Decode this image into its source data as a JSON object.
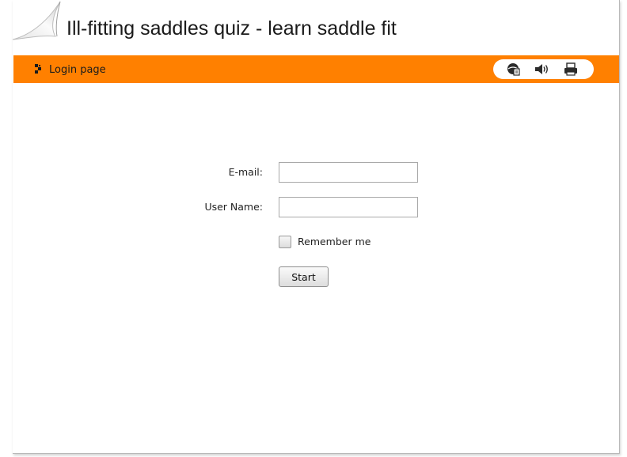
{
  "header": {
    "title": "Ill-fitting saddles quiz - learn saddle fit"
  },
  "navbar": {
    "breadcrumb": "Login page",
    "accent_color": "#ff8000",
    "tools": [
      {
        "icon": "help-globe-icon"
      },
      {
        "icon": "speaker-icon"
      },
      {
        "icon": "printer-icon"
      }
    ]
  },
  "form": {
    "email_label": "E-mail:",
    "email_value": "",
    "username_label": "User Name:",
    "username_value": "",
    "remember_label": "Remember me",
    "remember_checked": false,
    "start_label": "Start"
  }
}
